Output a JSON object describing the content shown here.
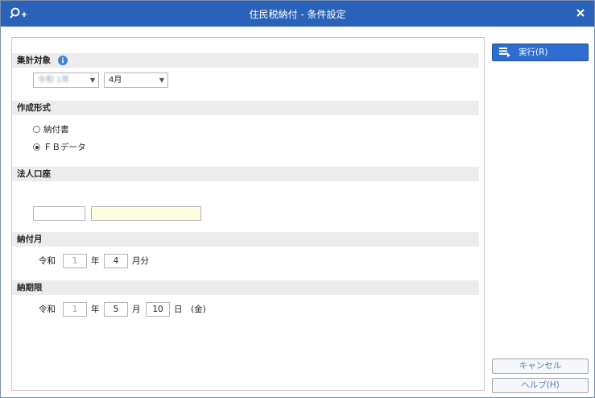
{
  "window": {
    "title": "住民税納付 - 条件設定"
  },
  "sections": {
    "aggregation": {
      "header": "集計対象",
      "year_select_value": "令和 1年",
      "month_select_value": "4月"
    },
    "format": {
      "header": "作成形式",
      "option_invoice": "納付書",
      "option_fb": "ＦＢデータ",
      "selected": "ＦＢデータ"
    },
    "account": {
      "header": "法人口座",
      "code_value": "",
      "name_value": ""
    },
    "payment_month": {
      "header": "納付月",
      "era": "令和",
      "year_value": "1",
      "year_unit": "年",
      "month_value": "4",
      "month_unit": "月分"
    },
    "deadline": {
      "header": "納期限",
      "era": "令和",
      "year_value": "1",
      "year_unit": "年",
      "month_value": "5",
      "month_unit": "月",
      "day_value": "10",
      "day_unit": "日",
      "weekday": "(金)"
    }
  },
  "buttons": {
    "execute": "実行(R)",
    "cancel": "キャンセル",
    "help": "ヘルプ(H)"
  },
  "colors": {
    "titlebar": "#2b62b9",
    "primary_button": "#2f6cd0",
    "section_header_bg": "#ececec",
    "highlight_field": "#fffde0"
  },
  "icons": {
    "app": "search-plus-icon",
    "info": "info-icon",
    "close": "close-icon",
    "execute": "execute-icon"
  }
}
